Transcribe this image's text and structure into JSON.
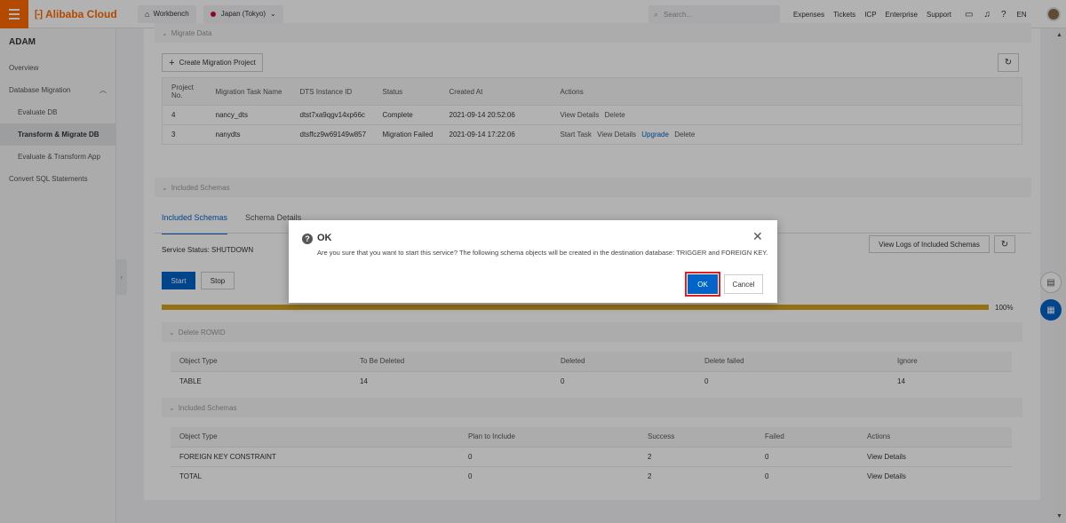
{
  "topbar": {
    "brand": "Alibaba Cloud",
    "workbench": "Workbench",
    "region": "Japan (Tokyo)",
    "search_placeholder": "Search...",
    "links": [
      "Expenses",
      "Tickets",
      "ICP",
      "Enterprise",
      "Support"
    ],
    "lang": "EN"
  },
  "sidebar": {
    "title": "ADAM",
    "items": [
      {
        "label": "Overview"
      },
      {
        "label": "Database Migration"
      },
      {
        "label": "Evaluate DB"
      },
      {
        "label": "Transform & Migrate DB"
      },
      {
        "label": "Evaluate & Transform App"
      },
      {
        "label": "Convert SQL Statements"
      }
    ]
  },
  "migrate": {
    "section_title": "Migrate Data",
    "create_label": "Create Migration Project",
    "columns": [
      "Project No.",
      "Migration Task Name",
      "DTS Instance ID",
      "Status",
      "Created At",
      "Actions"
    ],
    "rows": [
      {
        "no": "4",
        "name": "nancy_dts",
        "instance": "dtst7xa9qgv14xp66c",
        "status": "Complete",
        "created": "2021-09-14 20:52:06",
        "actions": [
          "View Details",
          "Delete"
        ]
      },
      {
        "no": "3",
        "name": "nanydts",
        "instance": "dtsffcz9w69149w857",
        "status": "Migration Failed",
        "created": "2021-09-14 17:22:06",
        "actions": [
          "Start Task",
          "View Details",
          "Upgrade",
          "Delete"
        ]
      }
    ]
  },
  "schemas": {
    "section_title": "Included Schemas",
    "tabs": [
      "Included Schemas",
      "Schema Details"
    ],
    "service_status": "Service Status: SHUTDOWN",
    "view_logs_label": "View Logs of Included Schemas",
    "start_label": "Start",
    "stop_label": "Stop",
    "progress": 1.0,
    "progress_text": "100%"
  },
  "delete_rowid": {
    "section_title": "Delete ROWID",
    "columns": [
      "Object Type",
      "To Be Deleted",
      "Deleted",
      "Delete failed",
      "Ignore"
    ],
    "rows": [
      [
        "TABLE",
        "14",
        "0",
        "0",
        "14"
      ]
    ]
  },
  "included": {
    "section_title": "Included Schemas",
    "columns": [
      "Object Type",
      "Plan to Include",
      "Success",
      "Failed",
      "Actions"
    ],
    "rows": [
      [
        "FOREIGN KEY CONSTRAINT",
        "0",
        "2",
        "0",
        "View Details"
      ],
      [
        "TOTAL",
        "0",
        "2",
        "0",
        "View Details"
      ]
    ]
  },
  "dialog": {
    "title": "OK",
    "message": "Are you sure that you want to start this service? The following schema objects will be created in the destination database: TRIGGER and FOREIGN KEY.",
    "ok_label": "OK",
    "cancel_label": "Cancel"
  },
  "colors": {
    "brand": "#ff6a00",
    "primary": "#0064c8",
    "progress": "#d4a21f",
    "highlight": "#e02020"
  }
}
